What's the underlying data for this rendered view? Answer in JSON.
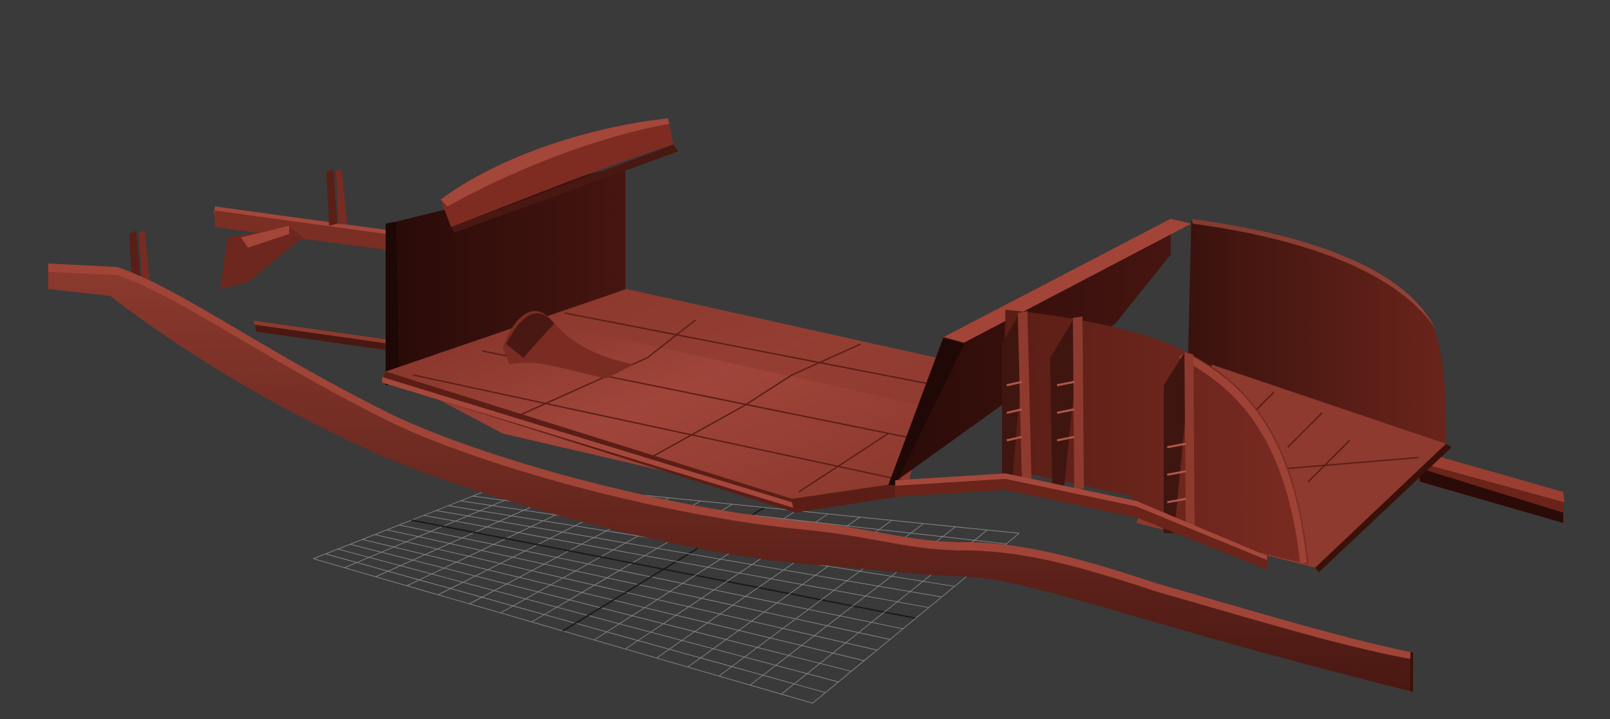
{
  "viewport": {
    "background_color": "#3a3a3a",
    "grid_color": "#9a9a9a",
    "grid_axis_color": "#111111",
    "model_colors": {
      "base": "#7a2e24",
      "light": "#9b3d30",
      "mid": "#6a2820",
      "dark": "#3f1510",
      "darkest": "#240a07",
      "edge": "#b3564a"
    },
    "model": "chassis-frame"
  }
}
